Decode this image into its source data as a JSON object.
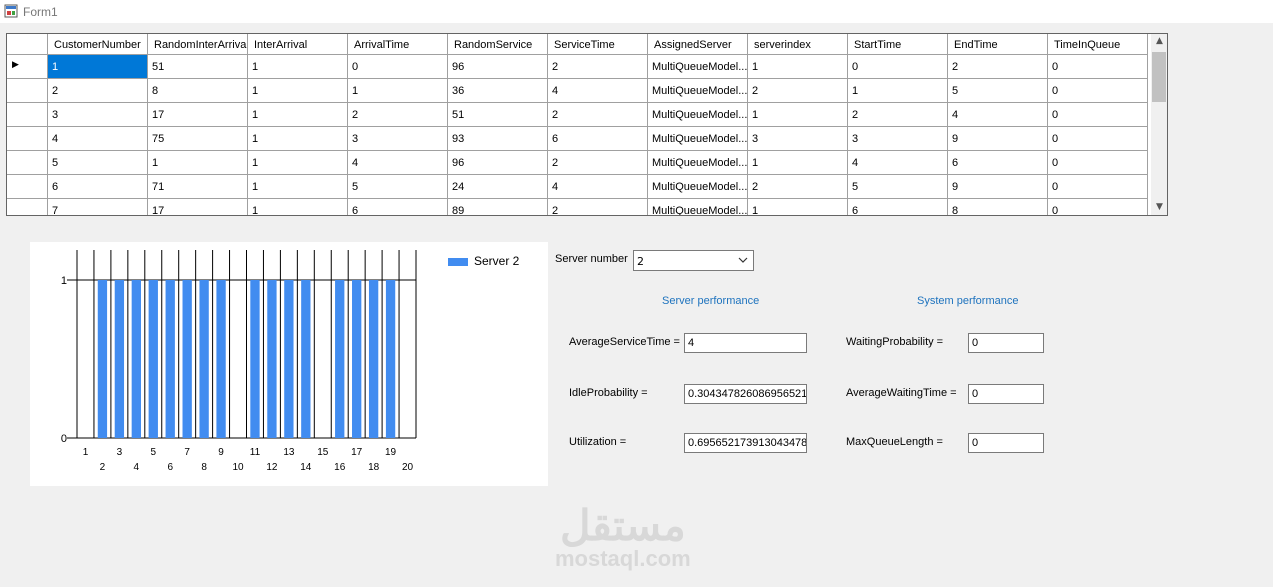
{
  "window": {
    "title": "Form1"
  },
  "grid": {
    "columns": [
      "CustomerNumber",
      "RandomInterArrival",
      "InterArrival",
      "ArrivalTime",
      "RandomService",
      "ServiceTime",
      "AssignedServer",
      "serverindex",
      "StartTime",
      "EndTime",
      "TimeInQueue"
    ],
    "rows": [
      [
        "1",
        "51",
        "1",
        "0",
        "96",
        "2",
        "MultiQueueModel...",
        "1",
        "0",
        "2",
        "0"
      ],
      [
        "2",
        "8",
        "1",
        "1",
        "36",
        "4",
        "MultiQueueModel...",
        "2",
        "1",
        "5",
        "0"
      ],
      [
        "3",
        "17",
        "1",
        "2",
        "51",
        "2",
        "MultiQueueModel...",
        "1",
        "2",
        "4",
        "0"
      ],
      [
        "4",
        "75",
        "1",
        "3",
        "93",
        "6",
        "MultiQueueModel...",
        "3",
        "3",
        "9",
        "0"
      ],
      [
        "5",
        "1",
        "1",
        "4",
        "96",
        "2",
        "MultiQueueModel...",
        "1",
        "4",
        "6",
        "0"
      ],
      [
        "6",
        "71",
        "1",
        "5",
        "24",
        "4",
        "MultiQueueModel...",
        "2",
        "5",
        "9",
        "0"
      ],
      [
        "7",
        "17",
        "1",
        "6",
        "89",
        "2",
        "MultiQueueModel...",
        "1",
        "6",
        "8",
        "0"
      ]
    ],
    "current_row_marker": "▶"
  },
  "chart_data": {
    "type": "bar",
    "x_ticks_top": [
      "1",
      "3",
      "5",
      "7",
      "9",
      "11",
      "13",
      "15",
      "17",
      "19"
    ],
    "x_ticks_bottom": [
      "2",
      "4",
      "6",
      "8",
      "10",
      "12",
      "14",
      "16",
      "18",
      "20"
    ],
    "y_ticks": [
      "0",
      "1"
    ],
    "ylim": [
      0,
      1
    ],
    "xlim": [
      1,
      20
    ],
    "series": [
      {
        "name": "Server 2",
        "color": "#418cf0",
        "x": [
          2,
          3,
          4,
          5,
          6,
          7,
          8,
          9,
          11,
          12,
          13,
          14,
          16,
          17,
          18,
          19
        ],
        "values": [
          1,
          1,
          1,
          1,
          1,
          1,
          1,
          1,
          1,
          1,
          1,
          1,
          1,
          1,
          1,
          1
        ]
      }
    ]
  },
  "server_select": {
    "label": "Server number",
    "value": "2"
  },
  "server_performance": {
    "title": "Server performance",
    "avg_service_label": "AverageServiceTime =",
    "avg_service_value": "4",
    "idle_label": "IdleProbability =",
    "idle_value": "0.304347826086956521",
    "util_label": "Utilization =",
    "util_value": "0.695652173913043478"
  },
  "system_performance": {
    "title": "System performance",
    "waiting_prob_label": "WaitingProbability =",
    "waiting_prob_value": "0",
    "avg_wait_label": "AverageWaitingTime =",
    "avg_wait_value": "0",
    "max_queue_label": "MaxQueueLength =",
    "max_queue_value": "0"
  },
  "watermark": {
    "arabic": "مستقل",
    "latin": "mostaql.com"
  }
}
